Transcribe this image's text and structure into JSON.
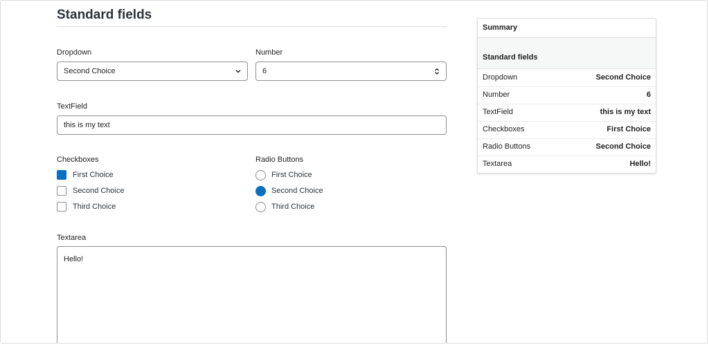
{
  "form": {
    "title": "Standard fields",
    "dropdown": {
      "label": "Dropdown",
      "value": "Second Choice"
    },
    "number": {
      "label": "Number",
      "value": "6"
    },
    "textfield": {
      "label": "TextField",
      "value": "this is my text"
    },
    "checkboxes": {
      "label": "Checkboxes",
      "options": [
        {
          "label": "First Choice",
          "checked": true
        },
        {
          "label": "Second Choice",
          "checked": false
        },
        {
          "label": "Third Choice",
          "checked": false
        }
      ]
    },
    "radios": {
      "label": "Radio Buttons",
      "options": [
        {
          "label": "First Choice",
          "checked": false
        },
        {
          "label": "Second Choice",
          "checked": true
        },
        {
          "label": "Third Choice",
          "checked": false
        }
      ]
    },
    "textarea": {
      "label": "Textarea",
      "value": "Hello!"
    }
  },
  "summary": {
    "title": "Summary",
    "section": "Standard fields",
    "rows": [
      {
        "key": "Dropdown",
        "value": "Second Choice"
      },
      {
        "key": "Number",
        "value": "6"
      },
      {
        "key": "TextField",
        "value": "this is my text"
      },
      {
        "key": "Checkboxes",
        "value": "First Choice"
      },
      {
        "key": "Radio Buttons",
        "value": "Second Choice"
      },
      {
        "key": "Textarea",
        "value": "Hello!"
      }
    ]
  },
  "colors": {
    "accent": "#0a6fc0",
    "border": "#8c8f94"
  }
}
